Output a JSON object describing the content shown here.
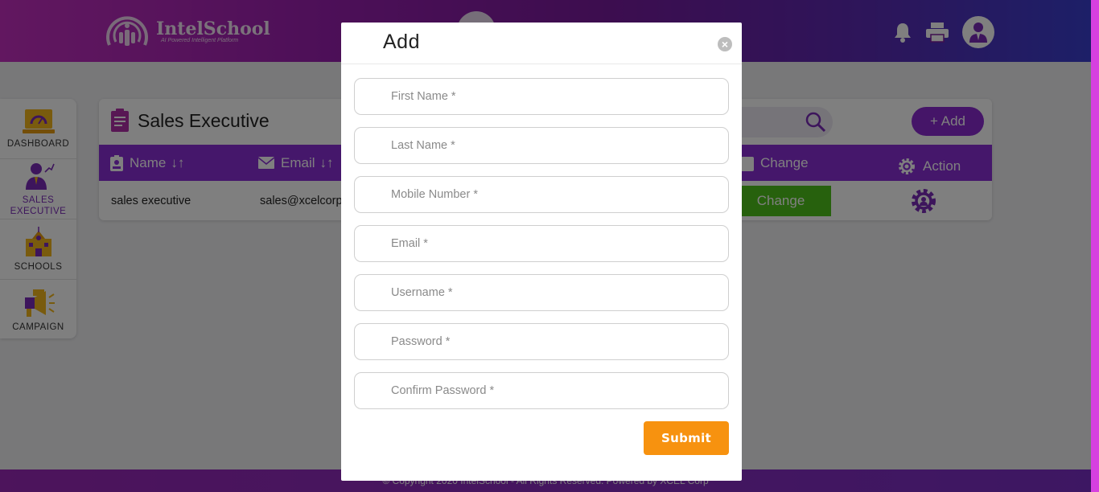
{
  "header": {
    "logo_name": "IntelSchool",
    "logo_tagline": "AI Powered Intelligent Platform"
  },
  "sidebar": {
    "items": [
      {
        "label": "DASHBOARD",
        "icon": "dashboard-icon"
      },
      {
        "label": "SALES EXECUTIVE",
        "icon": "sales-executive-icon"
      },
      {
        "label": "SCHOOLS",
        "icon": "school-icon"
      },
      {
        "label": "CAMPAIGN",
        "icon": "campaign-icon"
      }
    ]
  },
  "page": {
    "title": "Sales Executive",
    "add_label": "+ Add",
    "columns": {
      "name": "Name",
      "email": "Email",
      "change": "Change",
      "action": "Action"
    },
    "rows": [
      {
        "name": "sales executive",
        "email": "sales@xcelcorp",
        "change_label": "Change"
      }
    ]
  },
  "footer": {
    "text": "© Copyright 2020 IntelSchool - All Rights Reserved. Powered by XCEL Corp"
  },
  "modal": {
    "title": "Add",
    "close": "×",
    "fields": [
      {
        "placeholder": "First Name *"
      },
      {
        "placeholder": "Last Name *"
      },
      {
        "placeholder": "Mobile Number *"
      },
      {
        "placeholder": "Email *"
      },
      {
        "placeholder": "Username *"
      },
      {
        "placeholder": "Password *"
      },
      {
        "placeholder": "Confirm Password *"
      }
    ],
    "submit_label": "Submit"
  },
  "colors": {
    "primary": "#8a2fd6",
    "accent_orange": "#f7920f",
    "change_green": "#4fc21a"
  }
}
